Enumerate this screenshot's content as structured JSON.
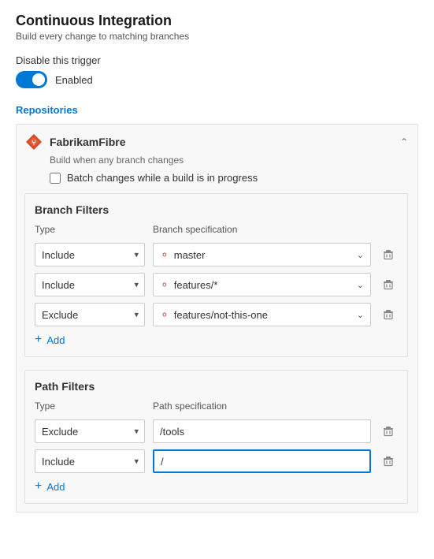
{
  "page": {
    "title": "Continuous Integration",
    "subtitle": "Build every change to matching branches"
  },
  "disable_trigger": {
    "label": "Disable this trigger",
    "toggle_state": "enabled",
    "toggle_label": "Enabled"
  },
  "repositories": {
    "section_title": "Repositories",
    "repo": {
      "name": "FabrikamFibre",
      "subtitle": "Build when any branch changes",
      "batch_label": "Batch changes while a build is in progress"
    }
  },
  "branch_filters": {
    "section_title": "Branch Filters",
    "type_label": "Type",
    "spec_label": "Branch specification",
    "rows": [
      {
        "type": "Include",
        "spec": "master"
      },
      {
        "type": "Include",
        "spec": "features/*"
      },
      {
        "type": "Exclude",
        "spec": "features/not-this-one"
      }
    ],
    "add_label": "Add"
  },
  "path_filters": {
    "section_title": "Path Filters",
    "type_label": "Type",
    "spec_label": "Path specification",
    "rows": [
      {
        "type": "Exclude",
        "spec": "/tools"
      },
      {
        "type": "Include",
        "spec": "/"
      }
    ],
    "add_label": "Add"
  },
  "icons": {
    "branch": "⑂",
    "delete": "🗑",
    "add": "+",
    "chevron_up": "^",
    "chevron_down": "v"
  }
}
